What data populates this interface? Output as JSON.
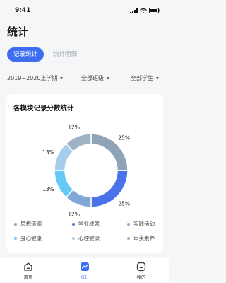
{
  "status": {
    "time": "9:41"
  },
  "title": "统计",
  "tabs": [
    {
      "label": "记录统计",
      "active": true
    },
    {
      "label": "统计明细",
      "active": false
    }
  ],
  "filters": [
    {
      "label": "2019~2020上学期"
    },
    {
      "label": "全部班级"
    },
    {
      "label": "全部学生"
    }
  ],
  "card": {
    "title": "各模块记录分数统计"
  },
  "chart_data": {
    "type": "pie",
    "categories": [
      "思想道德",
      "学业成就",
      "实践活动",
      "身心健康",
      "心理健康",
      "审美素养"
    ],
    "values": [
      25,
      25,
      12,
      13,
      13,
      12
    ],
    "labels": [
      "25%",
      "25%",
      "12%",
      "13%",
      "13%",
      "12%"
    ],
    "colors": [
      "#8fa3b8",
      "#4a73ea",
      "#7fa8d6",
      "#64c9f5",
      "#a6cdeb",
      "#9fb2c4"
    ]
  },
  "legend": [
    {
      "label": "思想道德",
      "color": "#8fa3b8"
    },
    {
      "label": "学业成就",
      "color": "#4a73ea"
    },
    {
      "label": "实践活动",
      "color": "#7fa8d6"
    },
    {
      "label": "身心健康",
      "color": "#64c9f5"
    },
    {
      "label": "心理健康",
      "color": "#a6cdeb"
    },
    {
      "label": "审美素养",
      "color": "#9fb2c4"
    }
  ],
  "tabbar": [
    {
      "label": "首页",
      "icon": "home-icon",
      "active": false
    },
    {
      "label": "统计",
      "icon": "chart-icon",
      "active": true
    },
    {
      "label": "我的",
      "icon": "profile-icon",
      "active": false
    }
  ]
}
